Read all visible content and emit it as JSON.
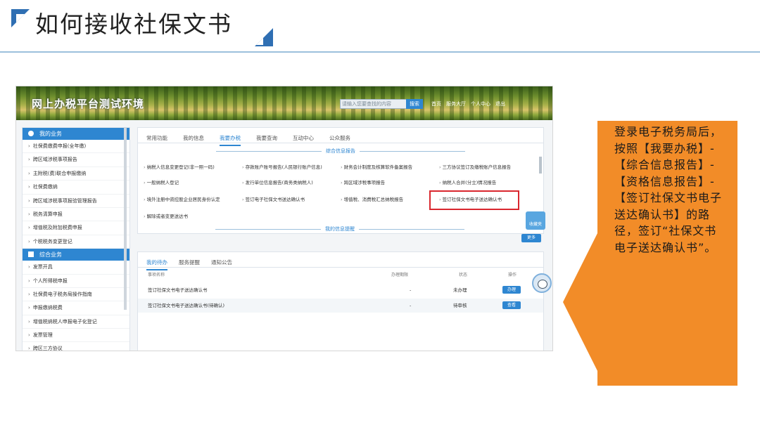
{
  "slide": {
    "title": "如何接收社保文书"
  },
  "portal": {
    "title": "网上办税平台测试环境",
    "search_placeholder": "请输入您要查找的内容",
    "search_button": "搜索",
    "header_links": "首页　服务大厅　个人中心　退出"
  },
  "sidebar": {
    "group1": "我的业务",
    "group1_items": [
      "社保费缴费申报(全年缴)",
      "跨区域涉税事项报告",
      "主附税(费)联合申报缴纳",
      "社保费缴纳",
      "跨区域涉税事项报验管理报告",
      "税务清算申报",
      "增值税及附加税费申报",
      "个税税务变更登记"
    ],
    "group2": "综合业务",
    "group2_items": [
      "发票开具",
      "个人所得税申报",
      "社保费电子税务局操作指南",
      "申报缴纳税费",
      "增值税纳税人申报电子化登记",
      "发票管理",
      "跨区三方协议"
    ]
  },
  "main_tabs": [
    "常用功能",
    "我的信息",
    "我要办税",
    "我要查询",
    "互动中心",
    "公众服务"
  ],
  "main_active_tab": "我要办税",
  "section1_title": "综合信息报告",
  "links": [
    [
      "纳税人信息变更登记(非一照一码)",
      "存款账户账号报告(人民银行账户信息)",
      "财务会计制度及核算软件备案报告",
      "三方协议签订及缴税账户信息报告"
    ],
    [
      "一般纳税人登记",
      "发行单位信息报告(商务类纳税人)",
      "跨区域涉税事项报告",
      "纳税人合并(分立)情况报告"
    ],
    [
      "境外注册中资控股企业居民身份认定",
      "签订电子社保文书送达确认书",
      "增值税、消费税汇总纳税报告",
      "签订社保文书电子送达确认书"
    ],
    [
      "解除或者变更送达书"
    ]
  ],
  "highlight_text": "签订社保文书电子送达确认书",
  "section2_title": "我的信息提醒",
  "collect_label": "收藏夹",
  "small_btn_label": "更多",
  "bottom_tabs": [
    "我的待办",
    "服务提醒",
    "通知公告"
  ],
  "bottom_active_tab": "我的待办",
  "table": {
    "headers": [
      "事项名称",
      "办理期限",
      "状态",
      "操作"
    ],
    "rows": [
      {
        "name": "签订社保文书电子送达确认书",
        "date": "-",
        "status": "未办理",
        "action": "办理"
      },
      {
        "name": "签订社保文书电子送达确认书(待确认)",
        "date": "-",
        "status": "待审核",
        "action": "查看"
      }
    ]
  },
  "callout": {
    "text": "登录电子税务局后，按照【我要办税】-【综合信息报告】-【资格信息报告】-【签订社保文书电子送达确认书】的路径，签订“社保文书电子送达确认书”。"
  },
  "colors": {
    "accent": "#2e86d1",
    "callout": "#f28c28",
    "highlight": "#d9272e"
  }
}
